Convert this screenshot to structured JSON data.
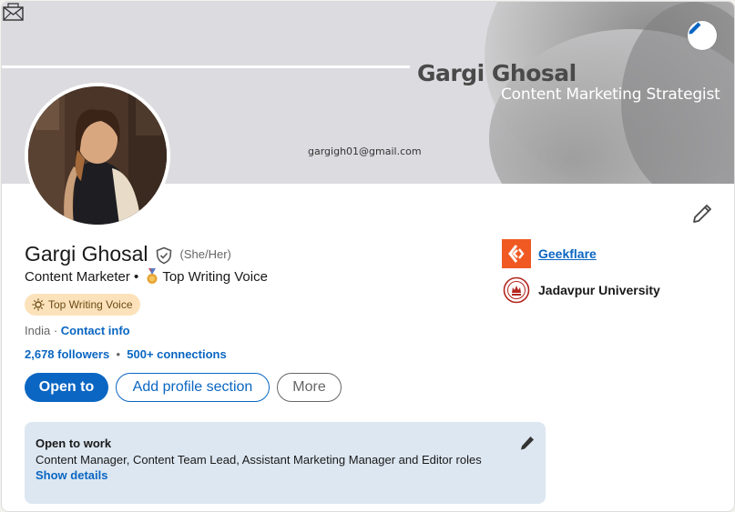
{
  "banner": {
    "name": "Gargi Ghosal",
    "role": "Content Marketing Strategist",
    "email": "gargigh01@gmail.com"
  },
  "profile": {
    "name": "Gargi Ghosal",
    "pronouns": "(She/Her)",
    "headline_role": "Content Marketer •",
    "headline_badge": "Top Writing Voice",
    "badge_label": "Top Writing Voice",
    "location": "India",
    "location_separator": "·",
    "contact_info": "Contact info",
    "followers": "2,678 followers",
    "connections": "500+ connections"
  },
  "buttons": {
    "open_to": "Open to",
    "add_section": "Add profile section",
    "more": "More"
  },
  "organizations": [
    {
      "name": "Geekflare"
    },
    {
      "name": "Jadavpur University"
    }
  ],
  "open_to_work": {
    "title": "Open to work",
    "description": "Content Manager, Content Team Lead, Assistant Marketing Manager and Editor roles",
    "link": "Show details"
  },
  "colors": {
    "accent": "#0a66c2",
    "badge_bg": "#fce2ba",
    "open_to_work_bg": "#dde7f1",
    "geekflare": "#f05a22"
  },
  "icons": [
    "pencil-icon",
    "envelope-icon",
    "verified-shield-icon",
    "medal-icon",
    "sun-badge-icon",
    "geekflare-logo",
    "jadavpur-logo"
  ]
}
